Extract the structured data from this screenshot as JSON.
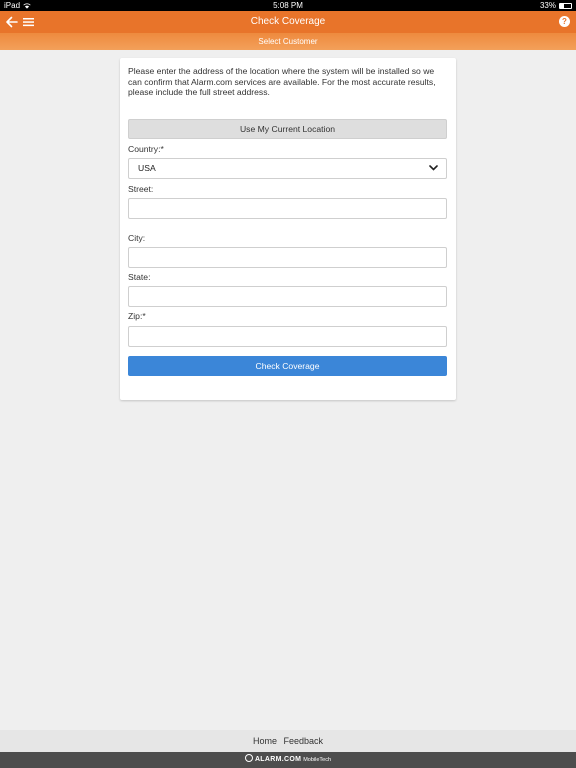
{
  "status_bar": {
    "device": "iPad",
    "time": "5:08 PM",
    "battery": "33%",
    "battery_level": 0.33
  },
  "header": {
    "title": "Check Coverage",
    "help_glyph": "?"
  },
  "subheader": {
    "label": "Select Customer"
  },
  "form": {
    "intro": "Please enter the address of the location where the system will be installed so we can confirm that Alarm.com services are available. For the most accurate results, please include the full street address.",
    "use_location_label": "Use My Current Location",
    "country_label": "Country:*",
    "country_value": "USA",
    "street_label": "Street:",
    "city_label": "City:",
    "state_label": "State:",
    "zip_label": "Zip:*",
    "submit_label": "Check Coverage"
  },
  "footer": {
    "home_label": "Home",
    "feedback_label": "Feedback",
    "brand": "ALARM.COM",
    "brand_sub": "MobileTech"
  },
  "colors": {
    "header": "#e8742a",
    "primary_button": "#3b86d8",
    "background": "#efefef"
  }
}
